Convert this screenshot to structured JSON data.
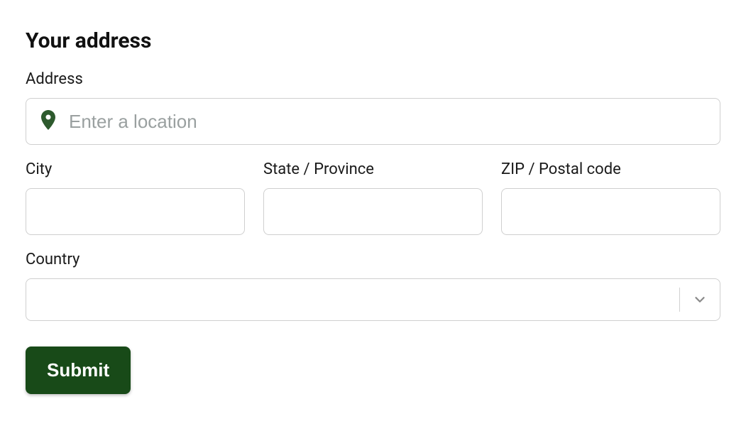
{
  "form": {
    "title": "Your address",
    "address": {
      "label": "Address",
      "placeholder": "Enter a location",
      "value": ""
    },
    "city": {
      "label": "City",
      "value": ""
    },
    "state": {
      "label": "State / Province",
      "value": ""
    },
    "zip": {
      "label": "ZIP / Postal code",
      "value": ""
    },
    "country": {
      "label": "Country",
      "value": ""
    },
    "submit_label": "Submit"
  },
  "colors": {
    "accent": "#184a18",
    "icon": "#2d5a2d"
  }
}
